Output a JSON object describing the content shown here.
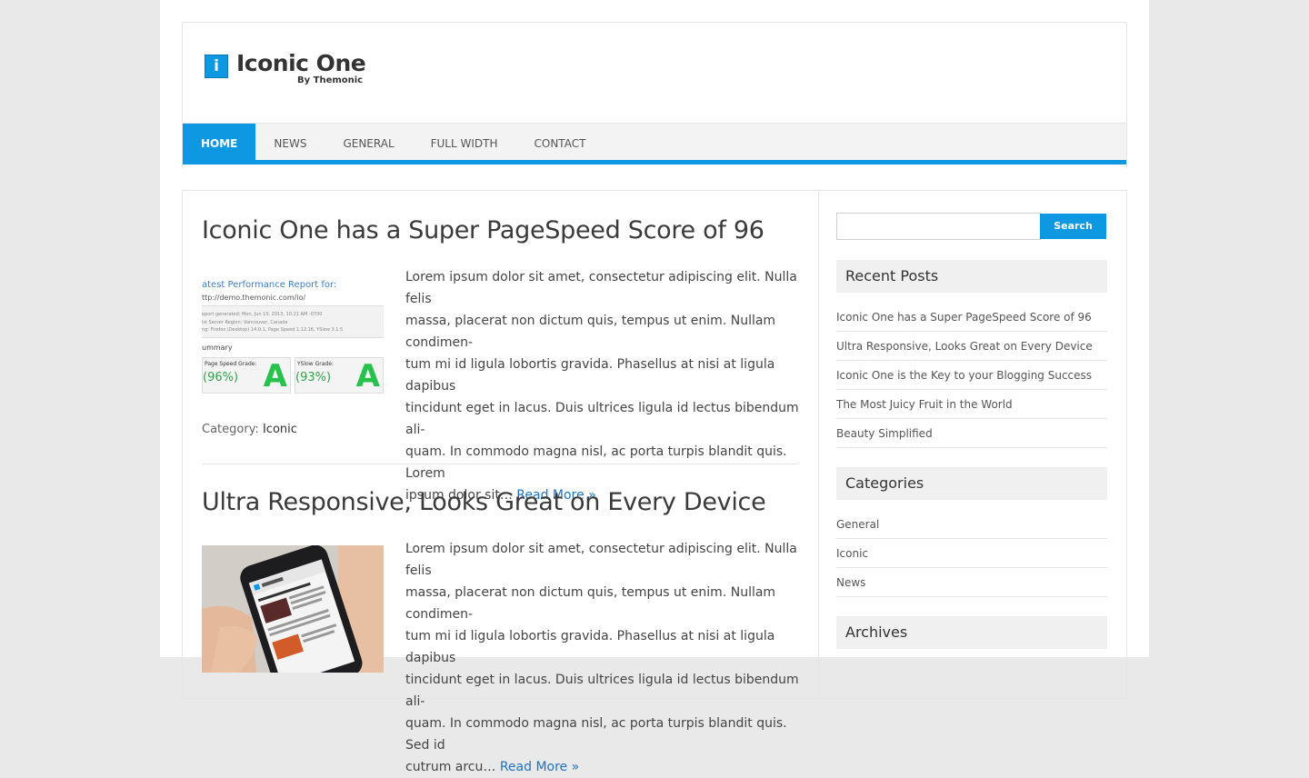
{
  "site": {
    "logo_letter": "i",
    "title": "Iconic One",
    "subtitle": "By Themonic"
  },
  "nav": [
    {
      "label": "HOME"
    },
    {
      "label": "NEWS"
    },
    {
      "label": "GENERAL"
    },
    {
      "label": "FULL WIDTH"
    },
    {
      "label": "CONTACT"
    }
  ],
  "posts": [
    {
      "title": "Iconic One has a Super PageSpeed Score of 96",
      "excerpt_lines": [
        "Lorem ipsum dolor sit amet, consectetur adipiscing elit. Nulla felis",
        "massa, placerat non dictum quis, tempus ut enim. Nullam condimen-",
        "tum mi id ligula lobortis gravida. Phasellus at nisi at ligula dapibus",
        "tincidunt eget in lacus. Duis ultrices ligula id lectus bibendum ali-",
        "quam. In commodo magna nisl, ac porta turpis blandit quis. Lorem",
        "ipsum dolor sit…"
      ],
      "read_more": "Read More »",
      "category_label": "Category:",
      "category": "Iconic",
      "thumb": {
        "heading": "atest Performance Report for:",
        "url": "ttp://demo.themonic.com/io/",
        "meta1": "eport generated: Mon, Jun 10, 2013, 10:21 AM -0700",
        "meta2": "ist Server Region: Vancouver, Canada",
        "meta3": "ng: Firefox (Desktop) 14.0.1, Page Speed 1.12.16, YSlow 3.1.5",
        "summary": "ummary",
        "grade1_label": "Page Speed Grade:",
        "grade1_value": "(96%)",
        "grade2_label": "YSlow Grade:",
        "grade2_value": "(93%)",
        "grade_letter": "A"
      }
    },
    {
      "title": "Ultra Responsive, Looks Great on Every Device",
      "excerpt_lines": [
        "Lorem ipsum dolor sit amet, consectetur adipiscing elit. Nulla felis",
        "massa, placerat non dictum quis, tempus ut enim. Nullam condimen-",
        "tum mi id ligula lobortis gravida. Phasellus at nisi at ligula dapibus",
        "tincidunt eget in lacus. Duis ultrices ligula id lectus bibendum ali-",
        "quam. In commodo magna nisl, ac porta turpis blandit quis. Sed id",
        "cutrum arcu…"
      ],
      "read_more": "Read More »"
    }
  ],
  "sidebar": {
    "search_button": "Search",
    "recent_title": "Recent Posts",
    "recent": [
      "Iconic One has a Super PageSpeed Score of 96",
      "Ultra Responsive, Looks Great on Every Device",
      "Iconic One is the Key to your Blogging Success",
      "The Most Juicy Fruit in the World",
      "Beauty Simplified"
    ],
    "categories_title": "Categories",
    "categories": [
      "General",
      "Iconic",
      "News"
    ],
    "archives_title": "Archives"
  },
  "colors": {
    "accent": "#0d98e1",
    "link": "#1e73be",
    "background": "#e9e9e9"
  }
}
